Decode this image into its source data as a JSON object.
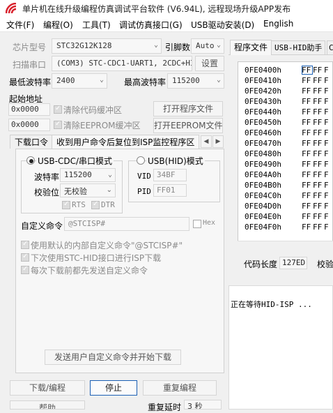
{
  "window": {
    "title": "单片机在线升级编程仿真调试平台软件 (V6.94L), 远程现场升级APP发布"
  },
  "menu": [
    "文件(F)",
    "编程(O)",
    "工具(T)",
    "调试仿真接口(G)",
    "USB驱动安装(D)",
    "English"
  ],
  "chip": {
    "label": "芯片型号",
    "value": "STC32G12K128",
    "pins_label": "引脚数",
    "pins_value": "Auto"
  },
  "port": {
    "label": "扫描串口",
    "value": "(COM3) STC-CDC1-UART1, 2CDC+HI",
    "settings": "设置"
  },
  "baud": {
    "min_label": "最低波特率",
    "min_value": "2400",
    "max_label": "最高波特率",
    "max_value": "115200"
  },
  "start_addr": {
    "label": "起始地址",
    "code_addr": "0x0000",
    "clear_code": "清除代码缓冲区",
    "open_program": "打开程序文件",
    "eeprom_addr": "0x0000",
    "clear_eeprom": "清除EEPROM缓冲区",
    "open_eeprom": "打开EEPROM文件"
  },
  "tabs": [
    "下载口令",
    "收到用户命令后复位到ISP监控程序区"
  ],
  "cdc": {
    "title": "USB-CDC/串口模式",
    "baud_label": "波特率",
    "baud_value": "115200",
    "parity_label": "校验位",
    "parity_value": "无校验",
    "rts": "RTS",
    "dtr": "DTR"
  },
  "hid": {
    "title": "USB(HID)模式",
    "vid_label": "VID",
    "vid_value": "34BF",
    "pid_label": "PID",
    "pid_value": "FF01"
  },
  "custom_cmd": {
    "label": "自定义命令",
    "value": "@STCISP#",
    "hex": "Hex",
    "opt1": "使用默认的内部自定义命令\"@STCISP#\"",
    "opt2": "下次使用STC-HID接口进行ISP下载",
    "opt3": "每次下载前都先发送自定义命令",
    "send_btn": "发送用户自定义命令并开始下载"
  },
  "bottom": {
    "download": "下载/编程",
    "stop": "停止",
    "reprogram": "重复编程",
    "help": "帮助",
    "redelay_label": "重复延时",
    "redelay_value": "3 秒"
  },
  "right": {
    "tabs": [
      "程序文件",
      "USB-HID助手",
      "C"
    ],
    "hex_rows": [
      {
        "addr": "0FE0400h",
        "bytes": [
          "FF",
          "FF",
          "F"
        ]
      },
      {
        "addr": "0FE0410h",
        "bytes": [
          "FF",
          "FF",
          "F"
        ]
      },
      {
        "addr": "0FE0420h",
        "bytes": [
          "FF",
          "FF",
          "F"
        ]
      },
      {
        "addr": "0FE0430h",
        "bytes": [
          "FF",
          "FF",
          "F"
        ]
      },
      {
        "addr": "0FE0440h",
        "bytes": [
          "FF",
          "FF",
          "F"
        ]
      },
      {
        "addr": "0FE0450h",
        "bytes": [
          "FF",
          "FF",
          "F"
        ]
      },
      {
        "addr": "0FE0460h",
        "bytes": [
          "FF",
          "FF",
          "F"
        ]
      },
      {
        "addr": "0FE0470h",
        "bytes": [
          "FF",
          "FF",
          "F"
        ]
      },
      {
        "addr": "0FE0480h",
        "bytes": [
          "FF",
          "FF",
          "F"
        ]
      },
      {
        "addr": "0FE0490h",
        "bytes": [
          "FF",
          "FF",
          "F"
        ]
      },
      {
        "addr": "0FE04A0h",
        "bytes": [
          "FF",
          "FF",
          "F"
        ]
      },
      {
        "addr": "0FE04B0h",
        "bytes": [
          "FF",
          "FF",
          "F"
        ]
      },
      {
        "addr": "0FE04C0h",
        "bytes": [
          "FF",
          "FF",
          "F"
        ]
      },
      {
        "addr": "0FE04D0h",
        "bytes": [
          "FF",
          "FF",
          "F"
        ]
      },
      {
        "addr": "0FE04E0h",
        "bytes": [
          "FF",
          "FF",
          "F"
        ]
      },
      {
        "addr": "0FE04F0h",
        "bytes": [
          "FF",
          "FF",
          "F"
        ]
      }
    ],
    "code_len_label": "代码长度",
    "code_len_value": "127ED",
    "checksum_label": "校验",
    "log": "正在等待HID-ISP ..."
  },
  "colors": {
    "accent": "#1a5fb4",
    "icon_red": "#d9232e"
  }
}
